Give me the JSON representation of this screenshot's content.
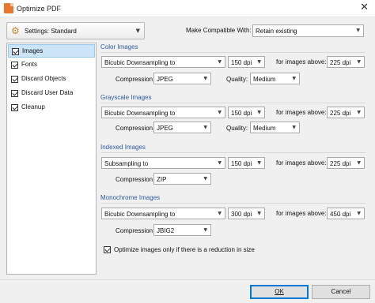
{
  "window": {
    "title": "Optimize PDF",
    "close_glyph": "✕"
  },
  "settings": {
    "label": "Settings:",
    "value": "Standard",
    "icon": "gear-icon"
  },
  "compat": {
    "label": "Make Compatible With:",
    "value": "Retain existing"
  },
  "sidebar": {
    "items": [
      {
        "label": "Images",
        "checked": true,
        "selected": true
      },
      {
        "label": "Fonts",
        "checked": true,
        "selected": false
      },
      {
        "label": "Discard Objects",
        "checked": true,
        "selected": false
      },
      {
        "label": "Discard User Data",
        "checked": true,
        "selected": false
      },
      {
        "label": "Cleanup",
        "checked": true,
        "selected": false
      }
    ]
  },
  "groups": {
    "color": {
      "title": "Color Images",
      "method": "Bicubic Downsampling to",
      "dpi": "150 dpi",
      "above_label": "for images above:",
      "above_dpi": "225 dpi",
      "compression_label": "Compression",
      "compression": "JPEG",
      "quality_label": "Quality:",
      "quality": "Medium"
    },
    "grayscale": {
      "title": "Grayscale Images",
      "method": "Bicubic Downsampling to",
      "dpi": "150 dpi",
      "above_label": "for images above:",
      "above_dpi": "225 dpi",
      "compression_label": "Compression",
      "compression": "JPEG",
      "quality_label": "Quality:",
      "quality": "Medium"
    },
    "indexed": {
      "title": "Indexed Images",
      "method": "Subsampling to",
      "dpi": "150 dpi",
      "above_label": "for images above:",
      "above_dpi": "225 dpi",
      "compression_label": "Compression",
      "compression": "ZIP"
    },
    "mono": {
      "title": "Monochrome Images",
      "method": "Bicubic Downsampling to",
      "dpi": "300 dpi",
      "above_label": "for images above:",
      "above_dpi": "450 dpi",
      "compression_label": "Compression",
      "compression": "JBIG2"
    }
  },
  "option": {
    "label": "Optimize images only if there is a reduction in size",
    "checked": true
  },
  "buttons": {
    "ok": "OK",
    "cancel": "Cancel"
  }
}
